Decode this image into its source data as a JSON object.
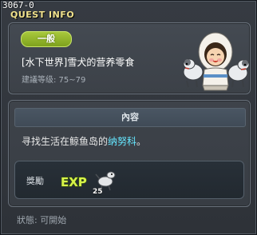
{
  "window": {
    "quest_id": "3067-0",
    "title": "QUEST INFO"
  },
  "header": {
    "category": "一般",
    "quest_name": "[水下世界]雪犬的营养零食",
    "level_requirement": "建議等级: 75~79",
    "npc_icon": "eskimo-girl-with-sled-dogs"
  },
  "content": {
    "section_title": "內容",
    "description_prefix": "寻找生活在鲸鱼岛的",
    "description_highlight": "纳努科",
    "description_suffix": "。",
    "highlight_color": "#65e6ff"
  },
  "reward": {
    "label": "獎勵",
    "exp_text": "EXP",
    "exp_icon": "exp-dog-icon",
    "exp_amount": "25"
  },
  "status": {
    "text": "狀態:  可開始"
  }
}
